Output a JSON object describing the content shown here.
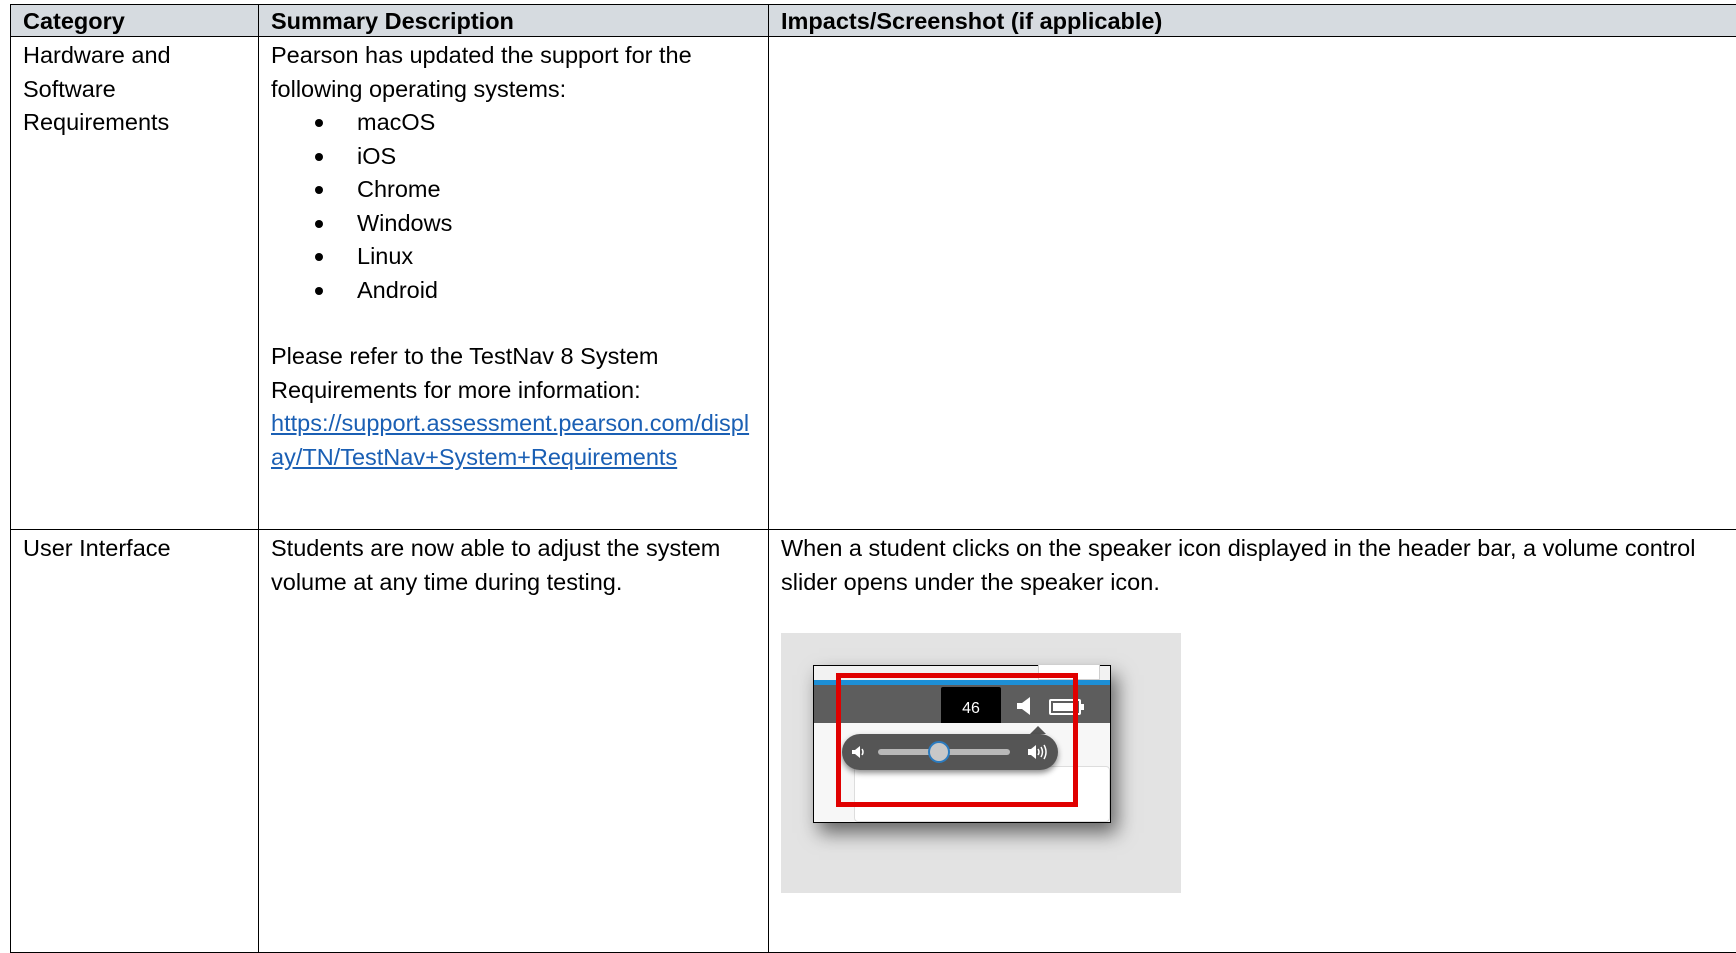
{
  "table": {
    "headers": [
      "Category",
      "Summary Description",
      "Impacts/Screenshot (if applicable)"
    ],
    "rows": [
      {
        "category": "Hardware and Software Requirements",
        "summary_intro": "Pearson has updated the support for the following operating systems:",
        "os_list": [
          "macOS",
          "iOS",
          "Chrome",
          "Windows",
          "Linux",
          "Android"
        ],
        "summary_refer": "Please refer to the TestNav 8 System Requirements for more information:",
        "link_text": "https://support.assessment.pearson.com/display/TN/TestNav+System+Requirements",
        "impacts": ""
      },
      {
        "category": "User Interface",
        "summary": "Students are now able to adjust the system volume at any time during testing.",
        "impacts": "When a student clicks on the speaker icon displayed in the header bar, a volume control slider opens under the speaker icon.",
        "screenshot": {
          "volume_value": "46",
          "volume_level": 0.46,
          "highlight_color": "#e00000",
          "header_color": "#5d5d5d",
          "accent_color": "#1d8fd6",
          "icons": [
            "speaker-icon",
            "battery-icon",
            "volume-low-icon",
            "volume-high-icon"
          ]
        }
      }
    ]
  },
  "colors": {
    "header_background": "#d6dbe0",
    "link": "#1a5fb4"
  }
}
